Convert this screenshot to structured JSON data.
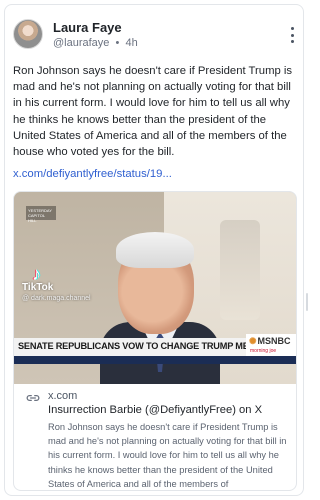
{
  "post": {
    "author_name": "Laura Faye",
    "author_handle": "@laurafaye",
    "time_ago": "4h",
    "text": "Ron Johnson says he doesn't care if President Trump is mad and he's not planning on actually voting for that bill in his current form. I would love for him to tell us all why he thinks he knows better than the president of the United States of America and all of the members of the house who voted yes for the bill.",
    "link_text": "x.com/defiyantlyfree/status/19..."
  },
  "video": {
    "bug_text": "YESTERDAY CAPITOL HILL",
    "tiktok_label": "TikTok",
    "tiktok_handle": "@ dark.maga.channel",
    "chyron": "SENATE REPUBLICANS VOW TO CHANGE TRUMP MEGABILL",
    "network": "MSNBC",
    "network_sub": "morning joe"
  },
  "link_card": {
    "domain": "x.com",
    "title": "Insurrection Barbie (@DefiyantlyFree) on X",
    "description": "Ron Johnson says he doesn't care if President Trump is mad and he's not planning on actually voting for that bill in his current form. I would love for him to tell us all why he thinks he knows better than the president of the United States of America and all of the members of"
  },
  "icons": {
    "more": "kebab-vertical-icon",
    "link": "link-icon",
    "tiktok": "tiktok-icon",
    "network": "peacock-icon"
  },
  "colors": {
    "link": "#2f5fd0",
    "text": "#1f2328",
    "muted": "#6b7280",
    "border": "#e3e6ea"
  }
}
